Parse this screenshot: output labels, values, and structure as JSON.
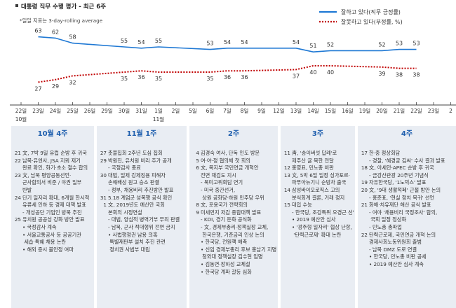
{
  "header": {
    "title": "대통령 직무 수행 평가 - 최근 6주",
    "note": "*일일 지표는 3-day-rolling average",
    "title_bullet_color": "#3a3a3a"
  },
  "legend": {
    "positive_label": "잘하고 있다(직무 긍정률)",
    "negative_label": "잘못하고 있다(부정률, %)"
  },
  "chart_data": {
    "type": "line",
    "title": "대통령 직무 수행 평가 - 최근 6주",
    "x": [
      "10-22",
      "10-23",
      "10-24",
      "10-25",
      "10-26",
      "10-29",
      "10-30",
      "10-31",
      "11-01",
      "11-02",
      "11-05",
      "11-06",
      "11-07",
      "11-08",
      "11-09",
      "11-12",
      "11-13",
      "11-14",
      "11-15",
      "11-16",
      "11-19",
      "11-20",
      "11-21",
      "11-22",
      "11-23"
    ],
    "x_tick_labels": [
      "22일",
      "23일",
      "24일",
      "25일",
      "26일",
      "29일",
      "30일",
      "31일",
      "1일",
      "2일",
      "5일",
      "6일",
      "7일",
      "8일",
      "9일",
      "12일",
      "13일",
      "14일",
      "15일",
      "16일",
      "19일",
      "20일",
      "21일",
      "22일",
      "23일",
      "2"
    ],
    "month_labels": [
      {
        "at": "10-22",
        "label": "10월"
      },
      {
        "at": "11-01",
        "label": "11월"
      }
    ],
    "series": [
      {
        "name": "잘하고 있다(직무 긍정률)",
        "color": "#1e78d4",
        "style": "solid",
        "values": [
          null,
          63,
          62,
          58,
          null,
          null,
          55,
          54,
          55,
          null,
          null,
          53,
          54,
          54,
          null,
          null,
          54,
          51,
          52,
          null,
          null,
          52,
          53,
          53,
          null
        ],
        "labeled": [
          false,
          true,
          true,
          true,
          false,
          false,
          true,
          true,
          true,
          false,
          false,
          true,
          true,
          true,
          false,
          false,
          true,
          true,
          true,
          false,
          false,
          true,
          true,
          true,
          false
        ]
      },
      {
        "name": "잘못하고 있다(부정률, %)",
        "color": "#c00000",
        "style": "dotted",
        "values": [
          null,
          27,
          29,
          32,
          null,
          null,
          35,
          36,
          35,
          null,
          null,
          35,
          36,
          36,
          null,
          null,
          37,
          40,
          40,
          null,
          null,
          39,
          38,
          38,
          null
        ],
        "labeled": [
          false,
          true,
          true,
          true,
          false,
          false,
          true,
          true,
          true,
          false,
          false,
          true,
          true,
          true,
          false,
          false,
          true,
          true,
          true,
          false,
          false,
          true,
          true,
          true,
          false
        ]
      }
    ],
    "ylim": [
      20,
      70
    ],
    "grid": false,
    "legend_position": "top-right"
  },
  "weeks": [
    {
      "title": "10월 4주",
      "events": [
        {
          "d": "21",
          "t": "文, 7박 9일 유럽 순방 후 귀국"
        },
        {
          "d": "22",
          "t": "남북·유엔사, JSA 지뢰 제거"
        },
        {
          "d": "",
          "t": "완료 확인, 화기·초소 철수 합의"
        },
        {
          "d": "23",
          "t": "文, 남북 평양공동선언·"
        },
        {
          "d": "",
          "t": "군사합의서 비준 / 야권 일부"
        },
        {
          "d": "",
          "t": "반발"
        },
        {
          "d": "24",
          "t": "단기 일자리 확대, 6개월 한시적"
        },
        {
          "d": "",
          "t": "유류세 인하 등 경제 대책 발표"
        },
        {
          "d": "",
          "t": "- 개성공단 기업인 방북 추진"
        },
        {
          "d": "25",
          "t": "유치원 공공성 강화 방안 발표"
        },
        {
          "d": "",
          "t": "• 국정감사 계속"
        },
        {
          "d": "",
          "t": "• 서울교통공사 등 공공기관"
        },
        {
          "d": "",
          "t": "  세습·특혜 채용 논란"
        },
        {
          "d": "",
          "t": "• 해외 증시 불안정 여파"
        }
      ]
    },
    {
      "title": "11월 1주",
      "events": [
        {
          "d": "27",
          "t": "촛불집회 2주년 도심 집회"
        },
        {
          "d": "29",
          "t": "박원진, 유치원 비리 추가 공개"
        },
        {
          "d": "",
          "t": "- 국정감사 종료"
        },
        {
          "d": "30",
          "t": "대법, 일제 강제징용 피해자"
        },
        {
          "d": "",
          "t": "손해배상 원고 승소 판결"
        },
        {
          "d": "",
          "t": "- 정부, 채용비리 추진방안 발표"
        },
        {
          "d": "31",
          "t": "5.18 계엄군 성폭행 공식 확인"
        },
        {
          "d": "1",
          "t": "文, 2019년도 예산안 국회"
        },
        {
          "d": "",
          "t": "본회의 시정연설"
        },
        {
          "d": "",
          "t": "- 대법, 양심적 병역거부 무죄 판결"
        },
        {
          "d": "",
          "t": "- 남북, 군사 적대행위 전면 금지"
        },
        {
          "d": "",
          "t": "• 사법행정권 남용 의혹"
        },
        {
          "d": "",
          "t": "  특별재판부 설치 추진 관련"
        },
        {
          "d": "",
          "t": "  정치권 사법부 대립"
        }
      ]
    },
    {
      "title": "2주",
      "events": [
        {
          "d": "4",
          "t": "김경숙 여사, 단독 인도 방문"
        },
        {
          "d": "5",
          "t": "여·야·정 협의체 첫 회의"
        },
        {
          "d": "6",
          "t": "文, 복지부 국민연금 개혁안"
        },
        {
          "d": "",
          "t": "전면 재검도 지시"
        },
        {
          "d": "",
          "t": "- 북미고위회담 연기"
        },
        {
          "d": "",
          "t": "- 미국 중간선거,"
        },
        {
          "d": "",
          "t": "  상원 공화당·하원 민주당 우위"
        },
        {
          "d": "8",
          "t": "文, 포용국가 전략회의"
        },
        {
          "d": "9",
          "t": "미세먼지 저감 종합대책 발표"
        },
        {
          "d": "",
          "t": "- KDI, 경기 둔화 공식화"
        },
        {
          "d": "",
          "t": "- 文, 경제부총리·정책실장 교체,"
        },
        {
          "d": "",
          "t": "  한국은행, 기준금리 인상 논의"
        },
        {
          "d": "",
          "t": "• 한국당, 전원책 해촉"
        },
        {
          "d": "",
          "t": "• 신임 경제부총리 후보 홍남기 지명,"
        },
        {
          "d": "",
          "t": "  청와대 정책실장 김수현 임명"
        },
        {
          "d": "",
          "t": "• 김동연·장하성 교체설"
        },
        {
          "d": "",
          "t": "• 한국당 계파 갈등 심화"
        }
      ]
    },
    {
      "title": "3주",
      "events": [
        {
          "d": "11",
          "t": "靑, '송이버섯 답례'로"
        },
        {
          "d": "",
          "t": "제주산 귤 북한 전달"
        },
        {
          "d": "12",
          "t": "홍영표, 민노총 비판"
        },
        {
          "d": "13",
          "t": "文, 5박 6일 일정 싱가포르·"
        },
        {
          "d": "",
          "t": "파푸아뉴기니 순방차 출국"
        },
        {
          "d": "14",
          "t": "삼성바이오로직스 고의"
        },
        {
          "d": "",
          "t": "분식회계 결론, 거래 정지"
        },
        {
          "d": "15",
          "t": "대입 수능"
        },
        {
          "d": "",
          "t": "- 한국당, 조강특위 오경근 선임"
        },
        {
          "d": "",
          "t": "• 2019 예산안 심사"
        },
        {
          "d": "",
          "t": "• '광주형 일자리' 협상 난항,"
        },
        {
          "d": "",
          "t": "  '탄력근로제' 확대 논란"
        }
      ]
    },
    {
      "title": "4주",
      "events": [
        {
          "d": "17",
          "t": "한·중 정상회담"
        },
        {
          "d": "",
          "t": "- 경찰, '혜경궁 김씨' 수사 결과 발표"
        },
        {
          "d": "18",
          "t": "文, 아세안·APEC 순방 후 귀국"
        },
        {
          "d": "",
          "t": "- 금강산관광 20주년 기념식"
        },
        {
          "d": "19",
          "t": "자유한국당, '1노믹스' 발표"
        },
        {
          "d": "20",
          "t": "文, '9대 생활적폐' 근절 방안 논의"
        },
        {
          "d": "",
          "t": "- 홍준표, '현실 정치 복귀' 선언"
        },
        {
          "d": "21",
          "t": "화해·치유재단 해산 공식 발표"
        },
        {
          "d": "",
          "t": "- 여야 '채용비리 국정조사' 합의,"
        },
        {
          "d": "",
          "t": "  국회 일정 정상화"
        },
        {
          "d": "",
          "t": "- 민노총 총파업"
        },
        {
          "d": "22",
          "t": "탄력근로제, 국민연금 개혁 논의"
        },
        {
          "d": "",
          "t": "경제사회노동위원회 출범"
        },
        {
          "d": "",
          "t": "- 남북 DMZ 도로 연결"
        },
        {
          "d": "",
          "t": "• 한국당, 민노총 비판 공세"
        },
        {
          "d": "",
          "t": "• 2019 예산안 심사 계속"
        }
      ]
    }
  ]
}
